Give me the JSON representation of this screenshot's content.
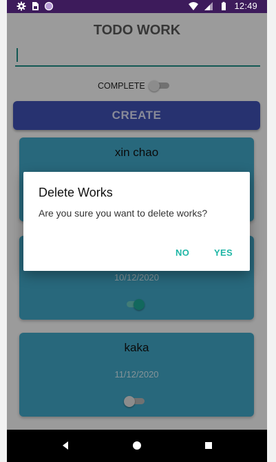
{
  "status_bar": {
    "time": "12:49",
    "left_icons": [
      "settings-icon",
      "sim-card-icon",
      "circle-icon"
    ],
    "right_icons": [
      "wifi-icon",
      "cell-signal-icon",
      "battery-icon"
    ]
  },
  "app": {
    "title": "TODO WORK",
    "input_value": "",
    "complete_label": "COMPLETE",
    "complete_on": false,
    "create_label": "CREATE"
  },
  "cards": [
    {
      "title": "xin chao",
      "date": "",
      "done": false
    },
    {
      "title": "",
      "date": "10/12/2020",
      "done": true
    },
    {
      "title": "kaka",
      "date": "11/12/2020",
      "done": false
    }
  ],
  "dialog": {
    "title": "Delete Works",
    "message": "Are you sure you want to delete works?",
    "no_label": "NO",
    "yes_label": "YES"
  },
  "colors": {
    "accent": "#1fb6a6",
    "primary": "#3f51b5",
    "card": "#41a8c8",
    "status_bar": "#3d1b5b"
  },
  "nav": [
    "back-icon",
    "home-icon",
    "recent-apps-icon"
  ]
}
